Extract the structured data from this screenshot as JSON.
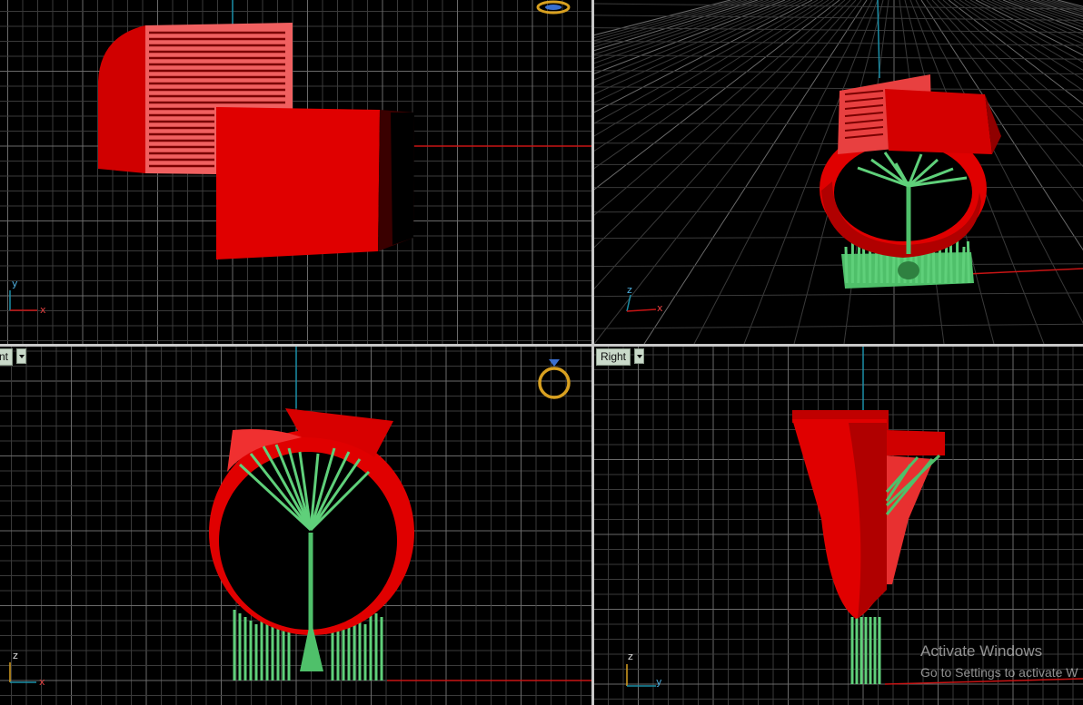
{
  "colors": {
    "background": "#000000",
    "grid_minor": "#3a3a3a",
    "grid_major": "#6a6a6a",
    "axis_x": "#c81414",
    "axis_y": "#1b8fa8",
    "model_red": "#e00000",
    "support_green": "#5fd07a",
    "divider": "#c8c8c8"
  },
  "viewports": {
    "top": {
      "gizmo_icon": "ring-gizmo-icon",
      "axis_labels": [
        "y",
        "x"
      ]
    },
    "perspective": {
      "axis_labels": [
        "z",
        "x"
      ]
    },
    "front": {
      "label": "nt",
      "gizmo_icon": "ring-gizmo-icon",
      "axis_labels": [
        "z",
        "x"
      ]
    },
    "right": {
      "label": "Right",
      "axis_labels": [
        "z",
        "y"
      ]
    }
  },
  "watermark": {
    "title": "Activate Windows",
    "subtitle": "Go to Settings to activate W"
  }
}
